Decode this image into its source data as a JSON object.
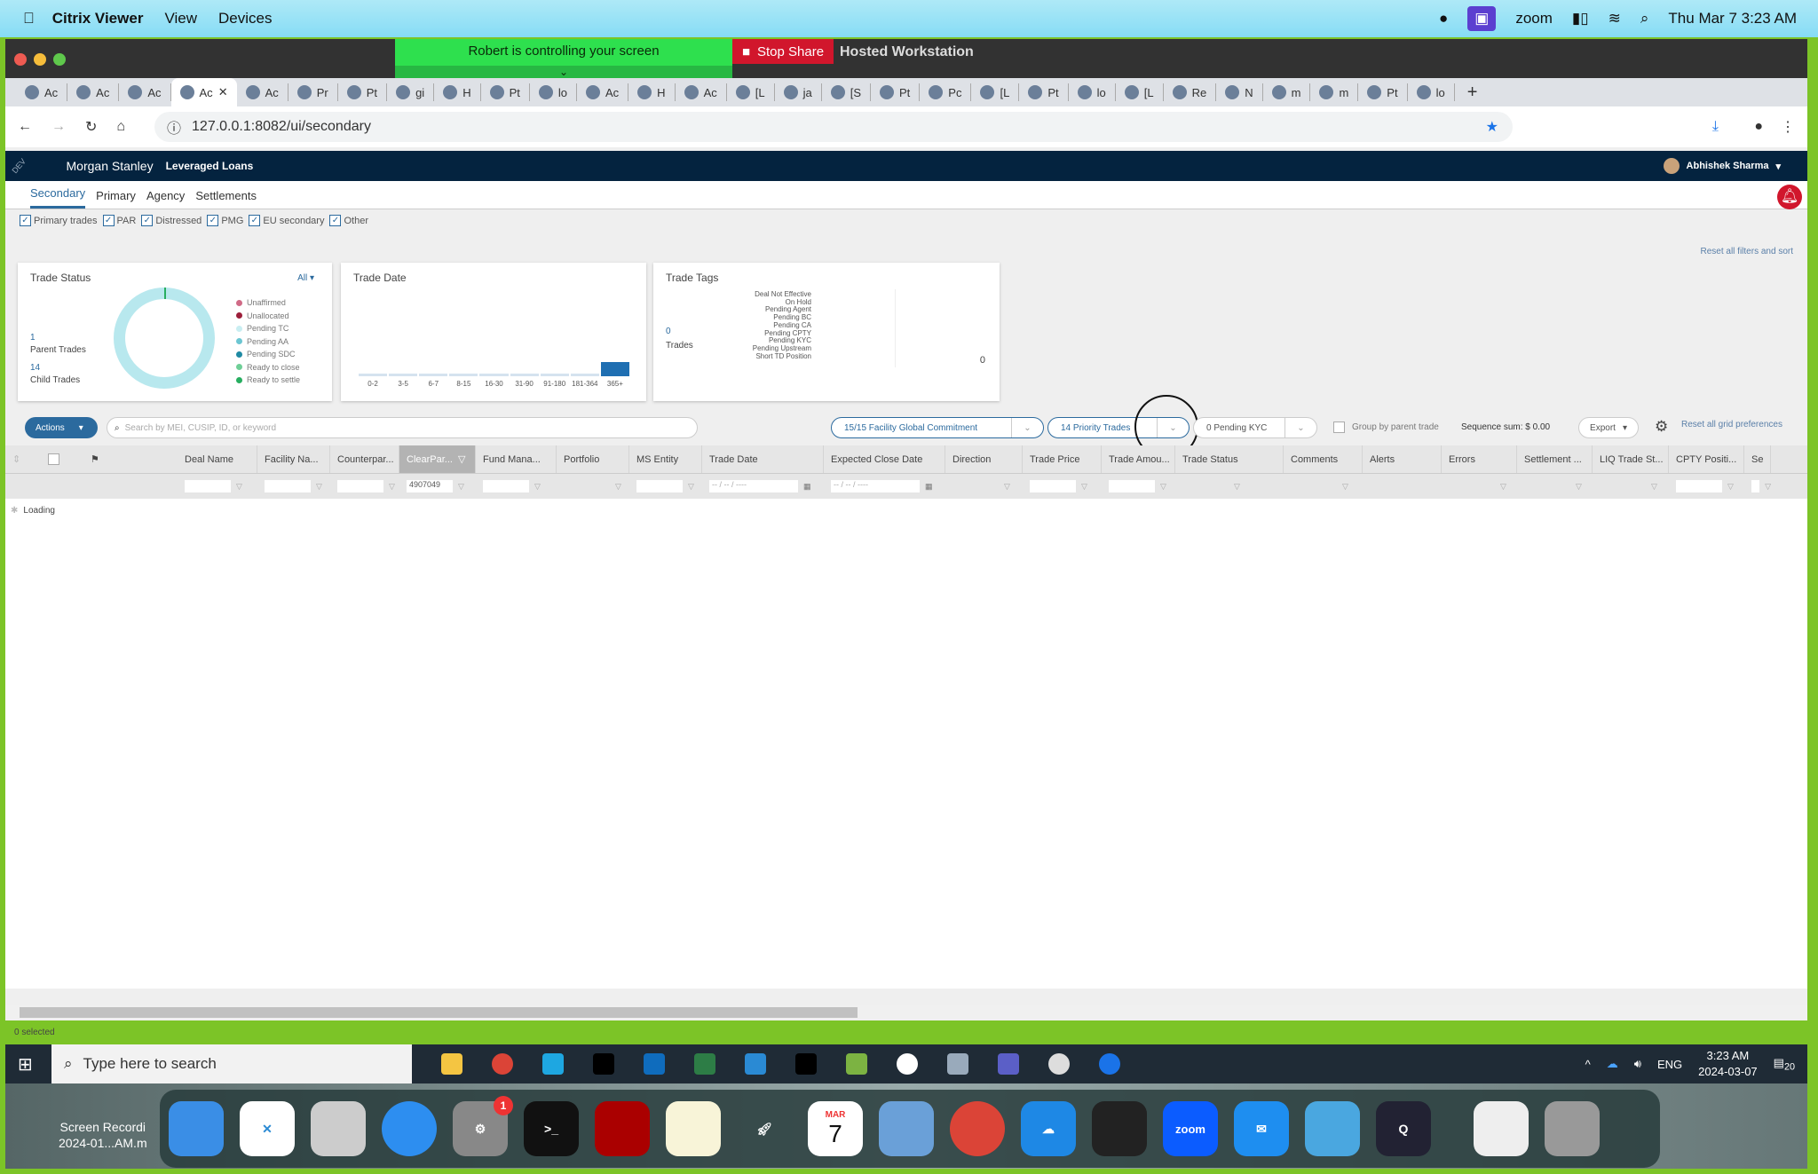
{
  "menubar": {
    "app": "Citrix Viewer",
    "items": [
      "View",
      "Devices"
    ],
    "zoom_label": "zoom",
    "clock": "Thu Mar 7  3:23 AM"
  },
  "zoom_share": {
    "controlling": "Robert is controlling your screen",
    "stop_share": "Stop Share",
    "window": "Hosted Workstation"
  },
  "browser": {
    "tabs": [
      "Ac",
      "Ac",
      "Ac",
      "Ac",
      "Ac",
      "Pr",
      "Pt",
      "gi",
      "H",
      "Pt",
      "lo",
      "Ac",
      "H",
      "Ac",
      "[L",
      "ja",
      "[S",
      "Pt",
      "Pc",
      "[L",
      "Pt",
      "lo",
      "[L",
      "Re",
      "N",
      "m",
      "m",
      "Pt",
      "lo"
    ],
    "active_tab": 3,
    "url": "127.0.0.1:8082/ui/secondary"
  },
  "app": {
    "env_badge": "DEV",
    "brand": "Morgan Stanley",
    "product": "Leveraged Loans",
    "user": "Abhishek Sharma",
    "nav": [
      "Secondary",
      "Primary",
      "Agency",
      "Settlements"
    ],
    "active_nav": 0,
    "filters": [
      "Primary trades",
      "PAR",
      "Distressed",
      "PMG",
      "EU secondary",
      "Other"
    ],
    "reset_filters": "Reset all filters and sort"
  },
  "trade_status": {
    "title": "Trade Status",
    "dropdown": "All",
    "parent_count": "1",
    "parent_label": "Parent Trades",
    "child_count": "14",
    "child_label": "Child Trades",
    "legend": [
      {
        "label": "Unaffirmed",
        "color": "#d06a86"
      },
      {
        "label": "Unallocated",
        "color": "#9c1f3a"
      },
      {
        "label": "Pending TC",
        "color": "#c9eef2"
      },
      {
        "label": "Pending AA",
        "color": "#6cc6d2"
      },
      {
        "label": "Pending SDC",
        "color": "#1f8aa3"
      },
      {
        "label": "Ready to close",
        "color": "#6fcf97"
      },
      {
        "label": "Ready to settle",
        "color": "#27ae60"
      }
    ]
  },
  "trade_date": {
    "title": "Trade Date",
    "buckets": [
      "0-2",
      "3-5",
      "6-7",
      "8-15",
      "16-30",
      "31-90",
      "91-180",
      "181-364",
      "365+"
    ],
    "values": [
      0,
      0,
      0,
      0,
      0,
      0,
      0,
      0,
      14
    ]
  },
  "trade_tags": {
    "title": "Trade Tags",
    "count": "0",
    "count_label": "Trades",
    "tags": [
      "Deal Not Effective",
      "On Hold",
      "Pending Agent",
      "Pending BC",
      "Pending CA",
      "Pending CPTY",
      "Pending KYC",
      "Pending Upstream",
      "Short TD Position"
    ],
    "axis_value": "0"
  },
  "toolbar": {
    "actions": "Actions",
    "search_placeholder": "Search by MEI, CUSIP, ID, or keyword",
    "pill1": "15/15  Facility Global Commitment",
    "pill2": "14  Priority Trades",
    "pill3": "0  Pending KYC",
    "group_by": "Group by parent trade",
    "sequence_sum": "Sequence sum: $ 0.00",
    "export": "Export",
    "reset_grid": "Reset all grid preferences"
  },
  "grid": {
    "columns": [
      "Deal Name",
      "Facility Na...",
      "Counterpar...",
      "ClearPar...",
      "Fund Mana...",
      "Portfolio",
      "MS Entity",
      "Trade Date",
      "Expected Close Date",
      "Direction",
      "Trade Price",
      "Trade Amou...",
      "Trade Status",
      "Comments",
      "Alerts",
      "Errors",
      "Settlement ...",
      "LIQ Trade St...",
      "CPTY Positi...",
      "Se"
    ],
    "clearpar_filter": "4907049",
    "date_placeholder": "-- / -- / ----",
    "loading": "Loading",
    "selected": "0 selected"
  },
  "taskbar": {
    "search_placeholder": "Type here to search",
    "lang": "ENG",
    "time": "3:23 AM",
    "date": "2024-03-07",
    "notif": "20"
  },
  "desktop": {
    "file_label1": "Screen Recordi",
    "file_label2": "2024-01...AM.m",
    "calendar_month": "MAR",
    "calendar_day": "7",
    "settings_badge": "1"
  }
}
